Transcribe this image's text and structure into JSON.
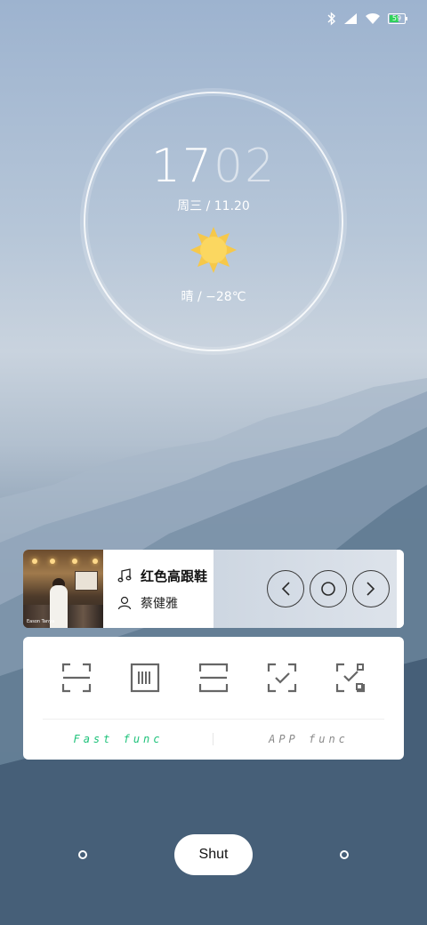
{
  "status_bar": {
    "battery_level": "59",
    "battery_color": "#2fd15b",
    "icons": [
      "bluetooth-icon",
      "signal-icon",
      "wifi-icon",
      "battery-icon"
    ]
  },
  "clock": {
    "hours": "17",
    "minutes": "02",
    "date": "周三 / 11.20",
    "weather_icon": "sun-icon",
    "weather": "晴 / −28℃"
  },
  "music": {
    "song_title": "红色高跟鞋",
    "artist": "蔡健雅",
    "album_caption": "Eason Tanya",
    "controls": [
      "previous-icon",
      "play-pause-icon",
      "next-icon"
    ]
  },
  "functions": {
    "icons": [
      "scan-frame-icon",
      "barcode-icon",
      "scan-line-icon",
      "scan-check-icon",
      "scan-check-dots-icon"
    ],
    "tabs": [
      {
        "label": "Fast func",
        "active": true
      },
      {
        "label": "APP func",
        "active": false
      }
    ],
    "active_color": "#1ec27a"
  },
  "bottom": {
    "shut_label": "Shut"
  }
}
